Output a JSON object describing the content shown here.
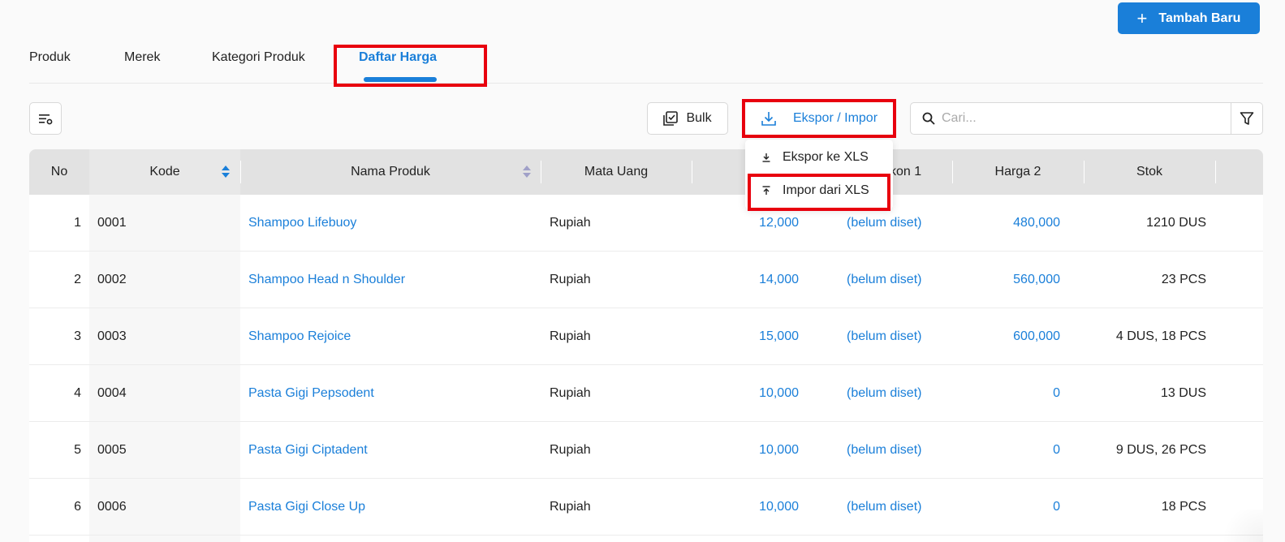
{
  "header": {
    "add_button_label": "Tambah Baru"
  },
  "tabs": [
    {
      "label": "Produk"
    },
    {
      "label": "Merek"
    },
    {
      "label": "Kategori Produk"
    },
    {
      "label": "Daftar Harga",
      "active": true
    }
  ],
  "toolbar": {
    "bulk_label": "Bulk",
    "export_import_label": "Ekspor / Impor",
    "search_placeholder": "Cari..."
  },
  "dropdown": {
    "items": [
      {
        "label": "Ekspor ke XLS",
        "icon": "download-icon"
      },
      {
        "label": "Impor dari XLS",
        "icon": "upload-icon"
      }
    ]
  },
  "table": {
    "columns": [
      "No",
      "Kode",
      "Nama Produk",
      "Mata Uang",
      "",
      "kon 1",
      "Harga 2",
      "Stok"
    ],
    "rows": [
      {
        "no": "1",
        "kode": "0001",
        "nama": "Shampoo Lifebuoy",
        "mata_uang": "Rupiah",
        "harga": "12,000",
        "diskon": "(belum diset)",
        "harga2": "480,000",
        "stok": "1210 DUS"
      },
      {
        "no": "2",
        "kode": "0002",
        "nama": "Shampoo Head n Shoulder",
        "mata_uang": "Rupiah",
        "harga": "14,000",
        "diskon": "(belum diset)",
        "harga2": "560,000",
        "stok": "23 PCS"
      },
      {
        "no": "3",
        "kode": "0003",
        "nama": "Shampoo Rejoice",
        "mata_uang": "Rupiah",
        "harga": "15,000",
        "diskon": "(belum diset)",
        "harga2": "600,000",
        "stok": "4 DUS, 18 PCS"
      },
      {
        "no": "4",
        "kode": "0004",
        "nama": "Pasta Gigi Pepsodent",
        "mata_uang": "Rupiah",
        "harga": "10,000",
        "diskon": "(belum diset)",
        "harga2": "0",
        "stok": "13 DUS"
      },
      {
        "no": "5",
        "kode": "0005",
        "nama": "Pasta Gigi Ciptadent",
        "mata_uang": "Rupiah",
        "harga": "10,000",
        "diskon": "(belum diset)",
        "harga2": "0",
        "stok": "9 DUS, 26 PCS"
      },
      {
        "no": "6",
        "kode": "0006",
        "nama": "Pasta Gigi Close Up",
        "mata_uang": "Rupiah",
        "harga": "10,000",
        "diskon": "(belum diset)",
        "harga2": "0",
        "stok": "18 PCS"
      }
    ]
  },
  "colors": {
    "accent": "#1a7fd9",
    "highlight": "#e8000e",
    "header_bg": "#e2e2e2"
  }
}
